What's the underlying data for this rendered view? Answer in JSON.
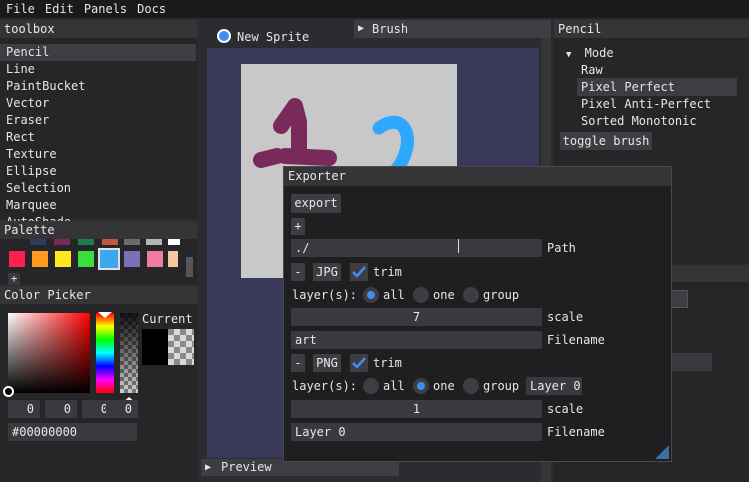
{
  "menu": [
    "File",
    "Edit",
    "Panels",
    "Docs"
  ],
  "toolbox": {
    "title": "toolbox",
    "items": [
      "Pencil",
      "Line",
      "PaintBucket",
      "Vector",
      "Eraser",
      "Rect",
      "Texture",
      "Ellipse",
      "Selection",
      "Marquee",
      "AutoShade"
    ],
    "selected": "Pencil"
  },
  "palette": {
    "title": "Palette",
    "top_colors": [
      "#2b3d5c",
      "#7a2a5a",
      "#1a7f4a",
      "#c0583c",
      "#6b6b6b",
      "#b4b4b4",
      "#ffffff"
    ],
    "colors": [
      "#ff1e4e",
      "#ff9a1e",
      "#ffe61e",
      "#3adf3a",
      "#3da8f0",
      "#7a72b8",
      "#f07aa0",
      "#f5c8a0"
    ],
    "selected_color": "#3da8f0",
    "add_label": "+"
  },
  "color_picker": {
    "title": "Color Picker",
    "current_label": "Current",
    "rgba": [
      "0",
      "0",
      "0",
      "0"
    ],
    "hex": "#00000000"
  },
  "canvas": {
    "tab_label": "New Sprite",
    "brush_label": "Brush",
    "preview_label": "Preview",
    "stroke_colors": [
      "#7a2a5a",
      "#2ea8ff"
    ]
  },
  "pencil": {
    "title": "Pencil",
    "mode_label": "Mode",
    "modes": [
      "Raw",
      "Pixel Perfect",
      "Pixel Anti-Perfect",
      "Sorted Monotonic"
    ],
    "selected_mode": "Pixel Perfect",
    "toggle_label": "toggle brush"
  },
  "exporter": {
    "title": "Exporter",
    "export_label": "export",
    "add_label": "+",
    "path_value": "./",
    "path_label": "Path",
    "remove_label": "-",
    "layers_label": "layer(s):",
    "all_label": "all",
    "one_label": "one",
    "group_label": "group",
    "scale_label": "scale",
    "filename_label": "Filename",
    "trim_label": "trim",
    "jpg": {
      "format": "JPG",
      "layer_mode": "all",
      "scale": "7",
      "filename": "art"
    },
    "png": {
      "format": "PNG",
      "layer_mode": "one",
      "layer_name": "Layer 0",
      "scale": "1",
      "filename": "Layer 0"
    }
  }
}
